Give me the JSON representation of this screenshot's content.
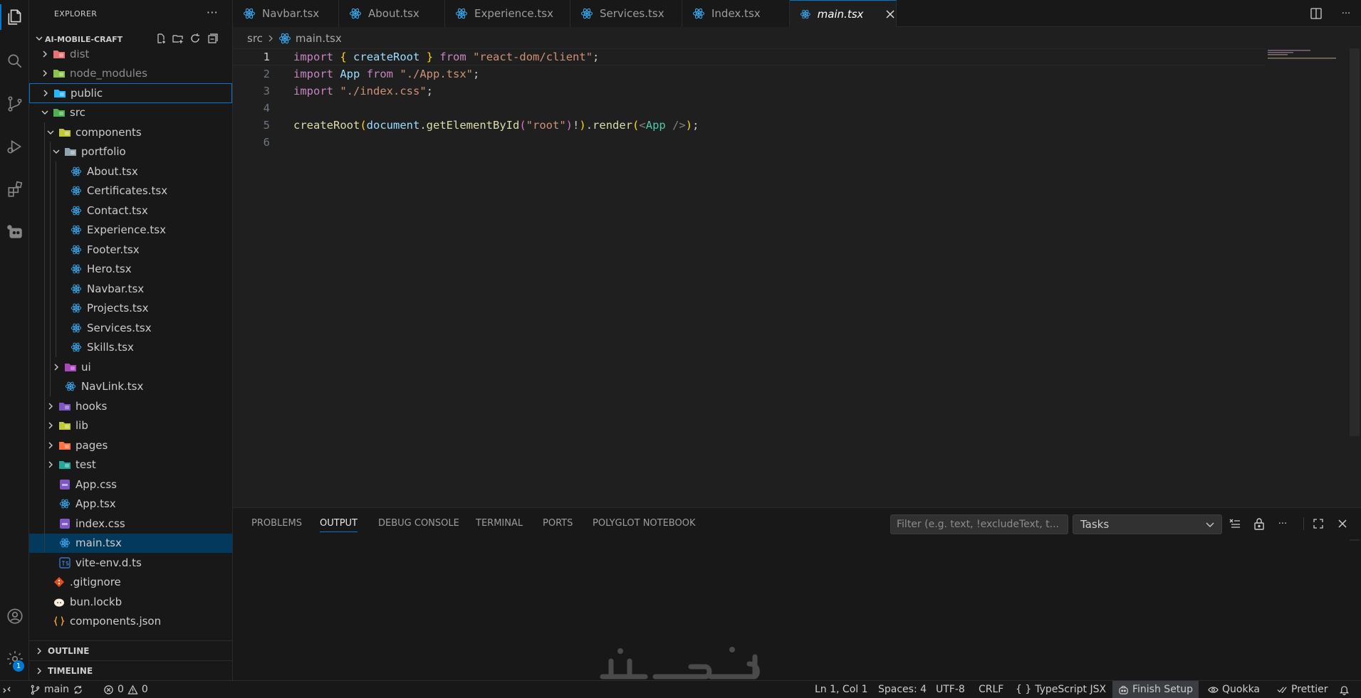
{
  "explorer": {
    "title": "EXPLORER",
    "project": "AI-MOBILE-CRAFT",
    "items": [
      {
        "label": "dist",
        "kind": "folder",
        "color": "#e57373"
      },
      {
        "label": "node_modules",
        "kind": "folder",
        "color": "#8bc34a"
      },
      {
        "label": "public",
        "kind": "folder",
        "color": "#29b6f6"
      },
      {
        "label": "src",
        "kind": "folder",
        "color": "#4caf50"
      },
      {
        "label": "components",
        "kind": "folder",
        "color": "#c0ca33"
      },
      {
        "label": "portfolio",
        "kind": "folder",
        "color": "#90a4ae"
      },
      {
        "label": "About.tsx",
        "kind": "react"
      },
      {
        "label": "Certificates.tsx",
        "kind": "react"
      },
      {
        "label": "Contact.tsx",
        "kind": "react"
      },
      {
        "label": "Experience.tsx",
        "kind": "react"
      },
      {
        "label": "Footer.tsx",
        "kind": "react"
      },
      {
        "label": "Hero.tsx",
        "kind": "react"
      },
      {
        "label": "Navbar.tsx",
        "kind": "react"
      },
      {
        "label": "Projects.tsx",
        "kind": "react"
      },
      {
        "label": "Services.tsx",
        "kind": "react"
      },
      {
        "label": "Skills.tsx",
        "kind": "react"
      },
      {
        "label": "ui",
        "kind": "folder",
        "color": "#ab47bc"
      },
      {
        "label": "NavLink.tsx",
        "kind": "react"
      },
      {
        "label": "hooks",
        "kind": "folder",
        "color": "#7e57c2"
      },
      {
        "label": "lib",
        "kind": "folder",
        "color": "#c0ca33"
      },
      {
        "label": "pages",
        "kind": "folder",
        "color": "#ff7043"
      },
      {
        "label": "test",
        "kind": "folder",
        "color": "#26a69a"
      },
      {
        "label": "App.css",
        "kind": "css"
      },
      {
        "label": "App.tsx",
        "kind": "react"
      },
      {
        "label": "index.css",
        "kind": "css"
      },
      {
        "label": "main.tsx",
        "kind": "react"
      },
      {
        "label": "vite-env.d.ts",
        "kind": "ts"
      },
      {
        "label": ".gitignore",
        "kind": "git"
      },
      {
        "label": "bun.lockb",
        "kind": "bun"
      },
      {
        "label": "components.json",
        "kind": "json"
      }
    ],
    "outline_label": "OUTLINE",
    "timeline_label": "TIMELINE",
    "settings_badge": "1"
  },
  "tabs": [
    {
      "label": "Navbar.tsx"
    },
    {
      "label": "About.tsx"
    },
    {
      "label": "Experience.tsx"
    },
    {
      "label": "Services.tsx"
    },
    {
      "label": "Index.tsx"
    },
    {
      "label": "main.tsx"
    }
  ],
  "breadcrumb": {
    "folder": "src",
    "file": "main.tsx"
  },
  "editor": {
    "line_numbers": [
      "1",
      "2",
      "3",
      "4",
      "5",
      "6"
    ]
  },
  "panel": {
    "tabs": [
      "PROBLEMS",
      "OUTPUT",
      "DEBUG CONSOLE",
      "TERMINAL",
      "PORTS",
      "POLYGLOT NOTEBOOK"
    ],
    "filter_placeholder": "Filter (e.g. text, !excludeText, t...",
    "selected_channel": "Tasks"
  },
  "status": {
    "branch": "main",
    "errors": "0",
    "warnings": "0",
    "position": "Ln 1, Col 1",
    "spaces": "Spaces: 4",
    "encoding": "UTF-8",
    "eol": "CRLF",
    "language_braces": "{ }",
    "language": "TypeScript JSX",
    "finish_setup": "Finish Setup",
    "quokka": "Quokka",
    "prettier": "Prettier"
  },
  "colors": {
    "accent": "#0078d4",
    "selection": "#04395e",
    "react_icon": "#3aa8f0"
  }
}
